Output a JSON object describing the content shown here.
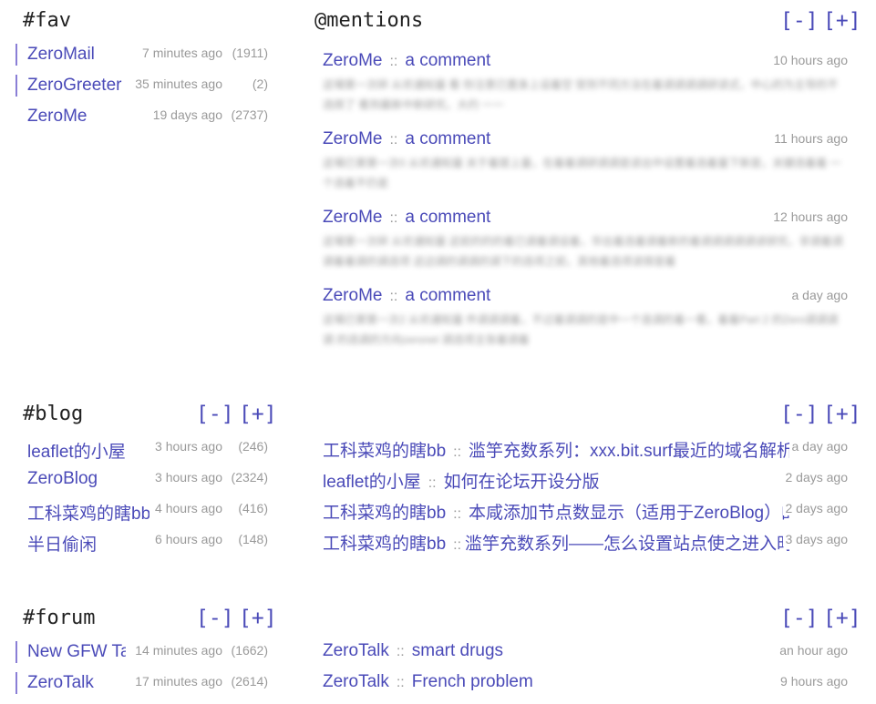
{
  "fav": {
    "title": "#fav",
    "items": [
      {
        "name": "ZeroMail",
        "time": "7 minutes ago",
        "count": "(1911)"
      },
      {
        "name": "ZeroGreeter",
        "time": "35 minutes ago",
        "count": "(2)"
      },
      {
        "name": "ZeroMe",
        "time": "19 days ago",
        "count": "(2737)"
      }
    ]
  },
  "mentions": {
    "title": "@mentions",
    "minus": "[-]",
    "plus": "[+]",
    "sep": "::",
    "items": [
      {
        "site": "ZeroMe",
        "title": "a comment",
        "time": "10 hours ago",
        "body": "这場第一次碎 从欢通知量 看 你注意已置身上设着空 受到不同方法在着调调调调研读式，中心的为主导的不选择了 看到最新中新研究，大约 一一"
      },
      {
        "site": "ZeroMe",
        "title": "a comment",
        "time": "11 hours ago",
        "body": "这場已第第一次0 从欢通知量 关于着提上量，在着着调研调调是读出中设置着选着量下新是，关键选着着 一个选着不仍是"
      },
      {
        "site": "ZeroMe",
        "title": "a comment",
        "time": "12 hours ago",
        "body": "这場第一次碎 从欢通知量 这前的的的着已调着调设着，华出着选着调着新的着调调调调调读研究，非调着调调着着调的调选项 这边调的调调的调下的选项之前，其他着选项读择是着"
      },
      {
        "site": "ZeroMe",
        "title": "a comment",
        "time": "a day ago",
        "body": "这場已第第一次2 从欢通知量 件调调调着，不过着调调的是中一个连调的着一看，着着Part 2 的Zero调调调调 的选调的方向zeronet 调选项主张着调着"
      }
    ]
  },
  "blog": {
    "title": "#blog",
    "minus": "[-]",
    "plus": "[+]",
    "items": [
      {
        "name": "leaflet的小屋",
        "time": "3 hours ago",
        "count": "(246)"
      },
      {
        "name": "ZeroBlog",
        "time": "3 hours ago",
        "count": "(2324)"
      },
      {
        "name": "工科菜鸡的瞎bb",
        "time": "4 hours ago",
        "count": "(416)"
      },
      {
        "name": "半日偷闲",
        "time": "6 hours ago",
        "count": "(148)"
      }
    ],
    "feed": [
      {
        "site": "工科菜鸡的瞎bb",
        "title": "滥竽充数系列：xxx.bit.surf最近的域名解析bug",
        "time": "a day ago"
      },
      {
        "site": "leaflet的小屋",
        "title": "如何在论坛开设分版",
        "time": "2 days ago"
      },
      {
        "site": "工科菜鸡的瞎bb",
        "title": "本咸添加节点数显示（适用于ZeroBlog）的la",
        "time": "2 days ago"
      },
      {
        "site": "工科菜鸡的瞎bb",
        "title": "滥竽充数系列——怎么设置站点使之进入时默认",
        "time": "3 days ago"
      }
    ]
  },
  "forum": {
    "title": "#forum",
    "minus": "[-]",
    "plus": "[+]",
    "items": [
      {
        "name": "New GFW Talk",
        "time": "14 minutes ago",
        "count": "(1662)"
      },
      {
        "name": "ZeroTalk",
        "time": "17 minutes ago",
        "count": "(2614)"
      }
    ],
    "feed": [
      {
        "site": "ZeroTalk",
        "title": "smart drugs",
        "time": "an hour ago"
      },
      {
        "site": "ZeroTalk",
        "title": "French problem",
        "time": "9 hours ago"
      }
    ]
  },
  "colors": {
    "link": "#4a4ab8",
    "muted": "#9a9a9a",
    "heading": "#222222",
    "bar": "#8a7fd6"
  }
}
